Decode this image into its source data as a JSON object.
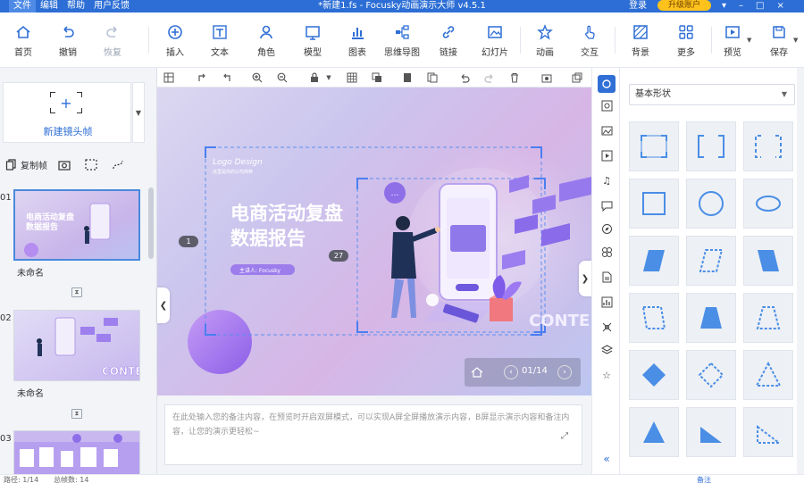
{
  "titlebar": {
    "menus": [
      "",
      "文件",
      "编辑",
      "帮助",
      "用户反馈"
    ],
    "title": "*新建1.fs - Focusky动画演示大师 v4.5.1",
    "login": "登录",
    "upgrade": "升级账户"
  },
  "toolbar": {
    "home": "首页",
    "undo": "撤销",
    "redo": "恢复",
    "insert": "插入",
    "text": "文本",
    "character": "角色",
    "template": "模型",
    "chart": "图表",
    "mindmap": "思维导图",
    "link": "链接",
    "slideshow": "幻灯片",
    "animation": "动画",
    "interact": "交互",
    "background": "背景",
    "more": "更多",
    "preview": "预览",
    "save": "保存"
  },
  "left": {
    "new_frame": "新建镜头帧",
    "copy_frame": "复制帧",
    "slides": [
      {
        "num": "01",
        "name": "未命名"
      },
      {
        "num": "02",
        "name": "未命名"
      },
      {
        "num": "03",
        "name": ""
      }
    ]
  },
  "canvas": {
    "logo_design": "Logo Design",
    "logo_sub": "这里是你的公司简称",
    "title_line1": "电商活动复盘",
    "title_line2": "数据报告",
    "reporter": "主讲人: Focusky",
    "badge_1": "1",
    "badge_27": "27",
    "bubble": "…",
    "content_text": "CONTE",
    "page_indicator": "01/14"
  },
  "notes": {
    "placeholder": "在此处输入您的备注内容，在预览时开启双屏模式，可以实现A屏全屏播放演示内容，B屏显示演示内容和备注内容，让您的演示更轻松~"
  },
  "right": {
    "shape_category": "基本形状"
  },
  "status": {
    "page": "路径: 1/14",
    "total": "总帧数: 14",
    "note": "备注"
  },
  "colors": {
    "titlebar": "#2c6ed5",
    "accent": "#2f6fd6",
    "shape": "#4a8ee6",
    "upgrade": "#ffc21c"
  }
}
